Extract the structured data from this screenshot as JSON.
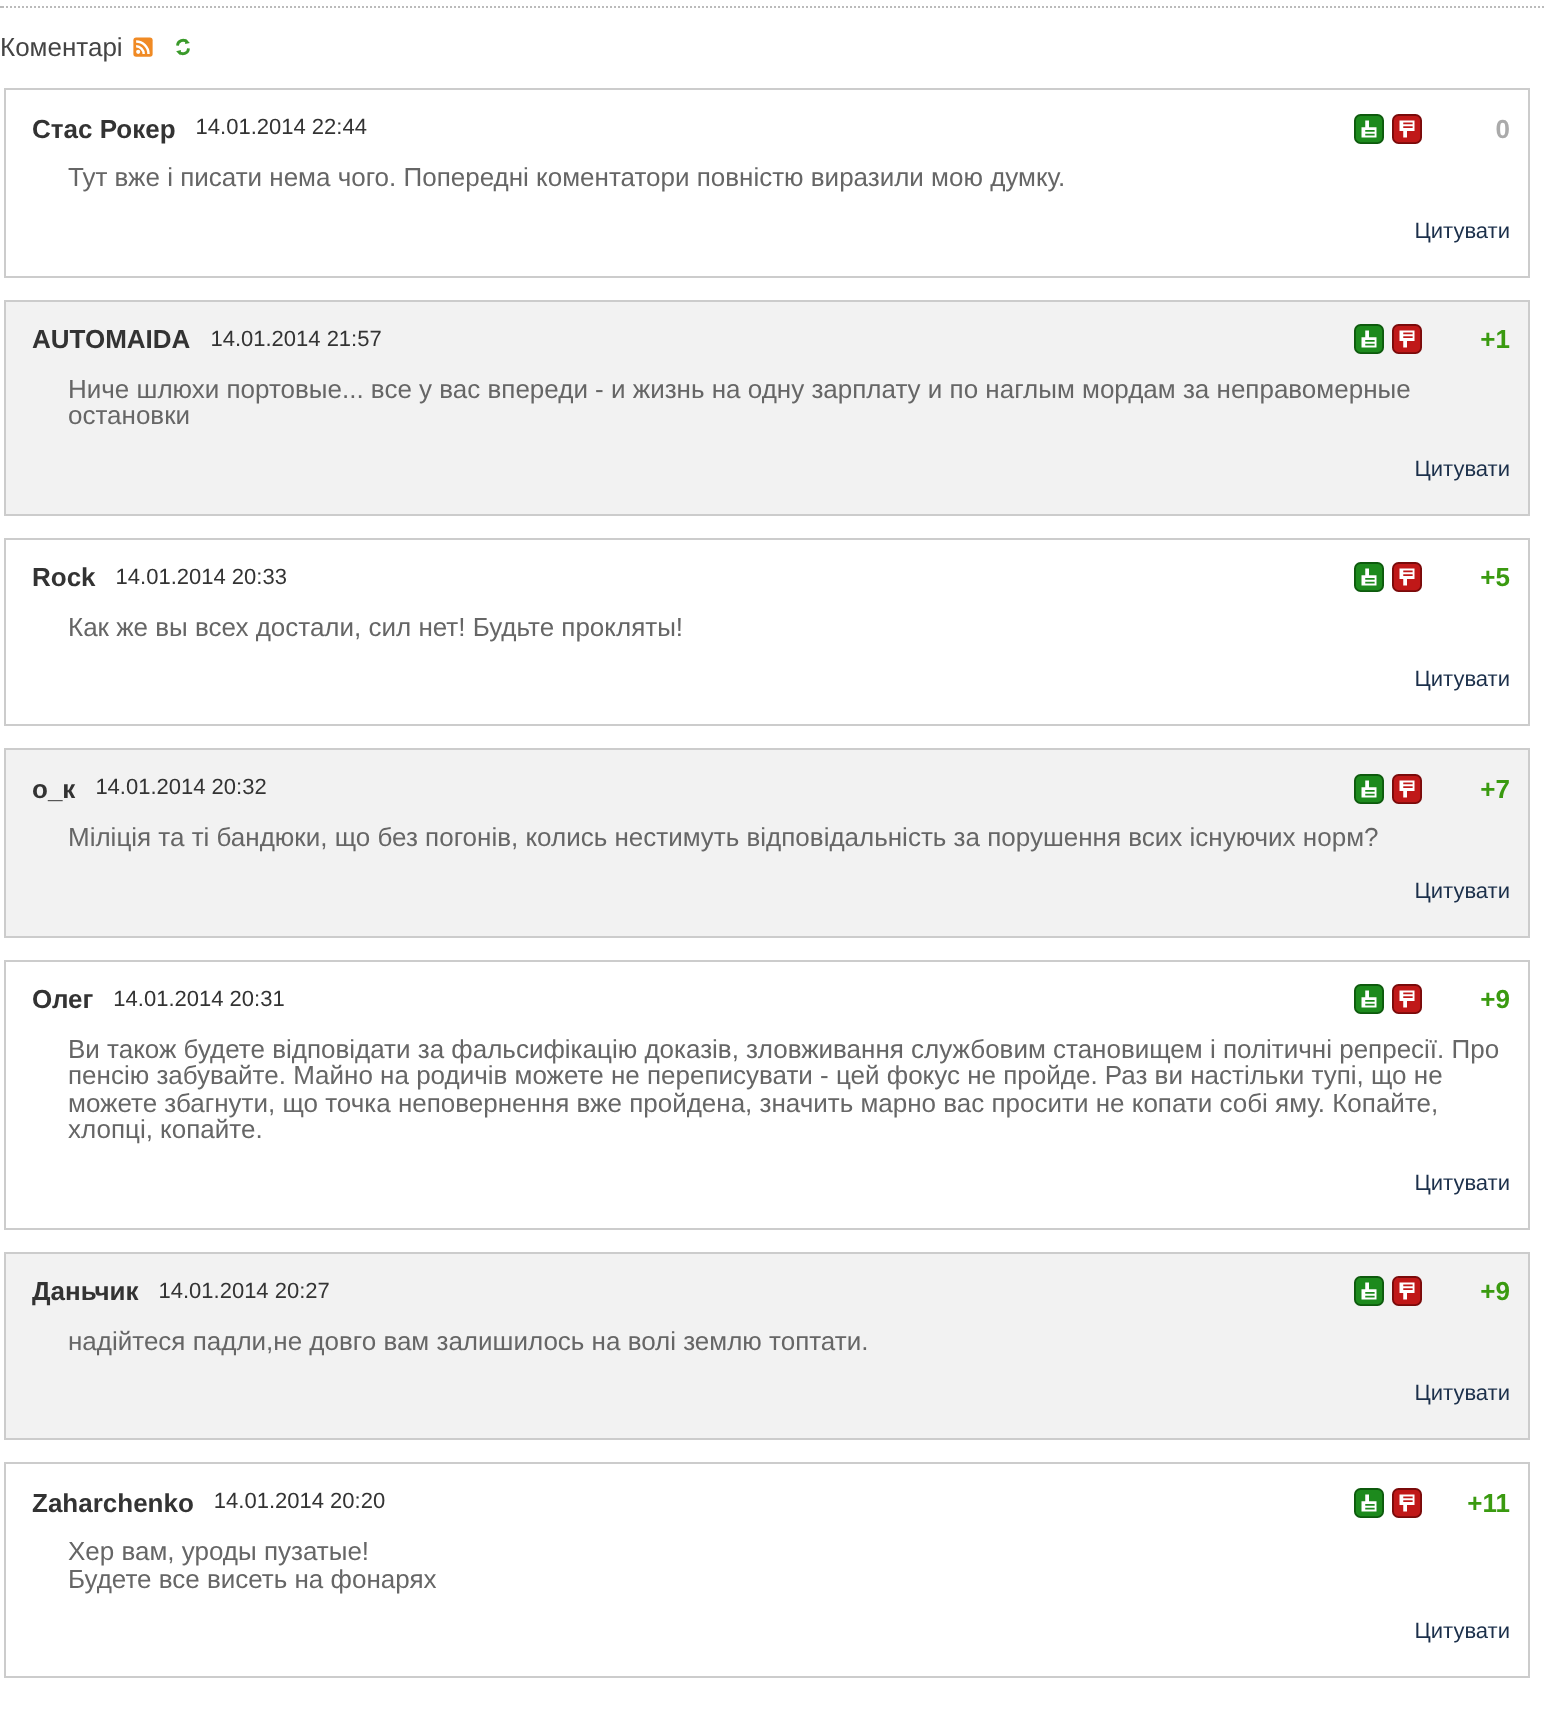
{
  "section": {
    "title": "Коментарі"
  },
  "comments": [
    {
      "author": "Стас Рокер",
      "date": "14.01.2014 22:44",
      "score": "0",
      "kind": "neutral",
      "shaded": false,
      "text": "Тут вже і писати нема чого. Попередні коментатори повністю виразили мою думку.",
      "quote": "Цитувати"
    },
    {
      "author": "AUTOMAIDA",
      "date": "14.01.2014 21:57",
      "score": "+1",
      "kind": "positive",
      "shaded": true,
      "text": "Ниче шлюхи портовые... все у вас впереди - и жизнь на одну зарплату и по наглым мордам за неправомерные остановки",
      "quote": "Цитувати"
    },
    {
      "author": "Rock",
      "date": "14.01.2014 20:33",
      "score": "+5",
      "kind": "positive",
      "shaded": false,
      "text": "Как же вы всех достали, сил нет! Будьте прокляты!",
      "quote": "Цитувати"
    },
    {
      "author": "o_к",
      "date": "14.01.2014 20:32",
      "score": "+7",
      "kind": "positive",
      "shaded": true,
      "text": "Міліція та ті бандюки, що без погонів, колись нестимуть відповідальність за порушення всих існуючих норм?",
      "quote": "Цитувати"
    },
    {
      "author": "Олег",
      "date": "14.01.2014 20:31",
      "score": "+9",
      "kind": "positive",
      "shaded": false,
      "text": "Ви також будете відповідати за фальсифікацію доказів, зловживання службовим становищем і політичні репресії. Про пенсію забувайте. Майно на родичів можете не переписувати - цей фокус не пройде. Раз ви настільки тупі, що не можете збагнути, що точка неповернення вже пройдена, значить марно вас просити не копати собі яму. Копайте, хлопці, копайте.",
      "quote": "Цитувати"
    },
    {
      "author": "Даньчик",
      "date": "14.01.2014 20:27",
      "score": "+9",
      "kind": "positive",
      "shaded": true,
      "text": "надійтеся падли,не довго вам залишилось на волі землю топтати.",
      "quote": "Цитувати"
    },
    {
      "author": "Zaharchenko",
      "date": "14.01.2014 20:20",
      "score": "+11",
      "kind": "positive",
      "shaded": false,
      "text": "Хер вам, уроды пузатые!\nБудете все висеть на фонарях",
      "quote": "Цитувати"
    }
  ]
}
